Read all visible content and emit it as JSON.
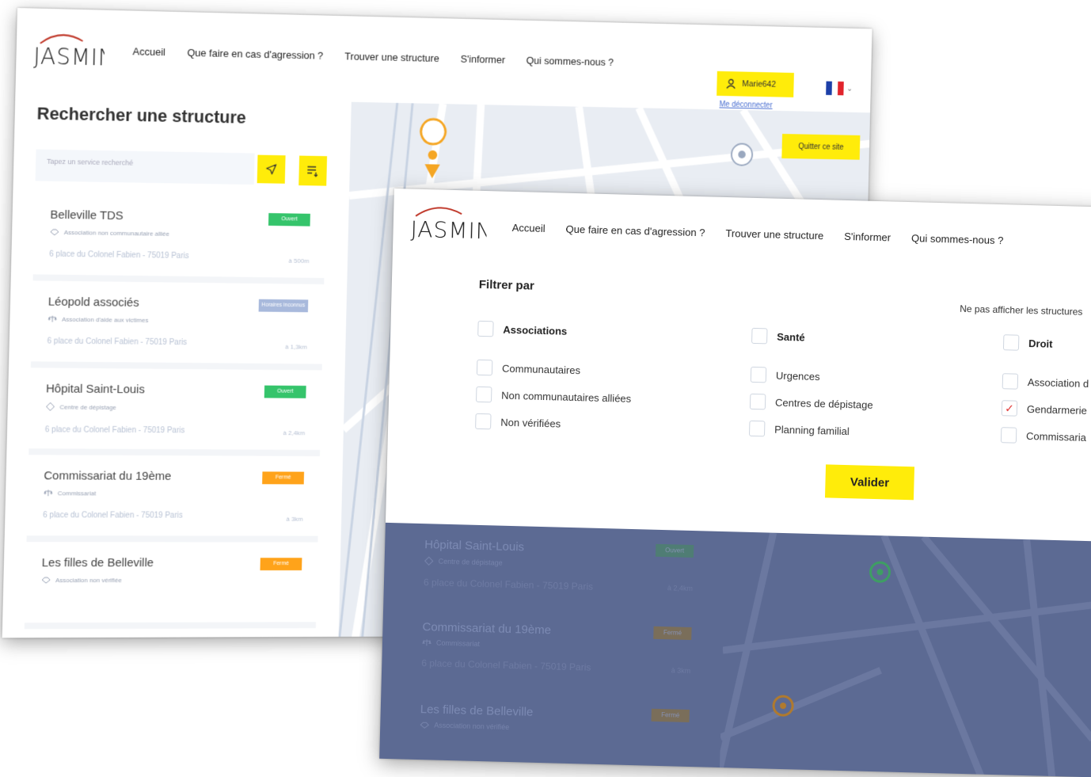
{
  "brand": {
    "name": "JASMINE"
  },
  "nav": [
    "Accueil",
    "Que faire en cas d'agression ?",
    "Trouver une structure",
    "S'informer",
    "Qui sommes-nous ?"
  ],
  "back_screen": {
    "user_label": "Marie642",
    "logout_label": "Me déconnecter",
    "page_title": "Rechercher une structure",
    "search_placeholder": "Tapez un service recherché",
    "quit_label": "Quitter ce site",
    "results": [
      {
        "title": "Belleville TDS",
        "type": "Association non communautaire alliée",
        "address": "6 place du Colonel Fabien - 75019 Paris",
        "distance": "à 500m",
        "status": "Ouvert",
        "status_color": "#35c46b"
      },
      {
        "title": "Léopold associés",
        "type": "Association d'aide aux victimes",
        "address": "6 place du Colonel Fabien - 75019 Paris",
        "distance": "à 1,3km",
        "status": "Horaires inconnus",
        "status_color": "#a8b9dc"
      },
      {
        "title": "Hôpital Saint-Louis",
        "type": "Centre de dépistage",
        "address": "6 place du Colonel Fabien - 75019 Paris",
        "distance": "à 2,4km",
        "status": "Ouvert",
        "status_color": "#35c46b"
      },
      {
        "title": "Commissariat du 19ème",
        "type": "Commissariat",
        "address": "6 place du Colonel Fabien - 75019 Paris",
        "distance": "à 3km",
        "status": "Fermé",
        "status_color": "#ffa31a"
      },
      {
        "title": "Les filles de Belleville",
        "type": "Association non vérifiée",
        "address": "",
        "distance": "",
        "status": "Fermé",
        "status_color": "#ffa31a"
      }
    ]
  },
  "filter": {
    "title": "Filtrer par",
    "hide_text": "Ne pas afficher les structures",
    "validate_label": "Valider",
    "columns": [
      {
        "heading": "Associations",
        "items": [
          {
            "label": "Communautaires",
            "checked": false
          },
          {
            "label": "Non communautaires alliées",
            "checked": false
          },
          {
            "label": "Non vérifiées",
            "checked": false
          }
        ]
      },
      {
        "heading": "Santé",
        "items": [
          {
            "label": "Urgences",
            "checked": false
          },
          {
            "label": "Centres de dépistage",
            "checked": false
          },
          {
            "label": "Planning familial",
            "checked": false
          }
        ]
      },
      {
        "heading": "Droit",
        "items": [
          {
            "label": "Association d",
            "checked": false
          },
          {
            "label": "Gendarmerie",
            "checked": true
          },
          {
            "label": "Commissaria",
            "checked": false
          }
        ]
      }
    ]
  },
  "overlay_results": [
    {
      "title": "Hôpital Saint-Louis",
      "type": "Centre de dépistage",
      "address": "6 place du Colonel Fabien - 75019 Paris",
      "distance": "à 2,4km",
      "status": "Ouvert"
    },
    {
      "title": "Commissariat du 19ème",
      "type": "Commissariat",
      "address": "6 place du Colonel Fabien - 75019 Paris",
      "distance": "à 3km",
      "status": "Fermé"
    },
    {
      "title": "Les filles de Belleville",
      "type": "Association non vérifiée",
      "address": "",
      "distance": "",
      "status": "Fermé"
    }
  ],
  "colors": {
    "accent": "#ffec0a",
    "logo_arc": "#c0392b",
    "open": "#35c46b",
    "closed": "#ffa31a",
    "unknown": "#a8b9dc",
    "overlay": "#5c6a93"
  },
  "icons": {
    "user": "user-icon",
    "locate": "location-arrow-icon",
    "filter": "filter-list-icon",
    "flag": "french-flag-icon"
  }
}
